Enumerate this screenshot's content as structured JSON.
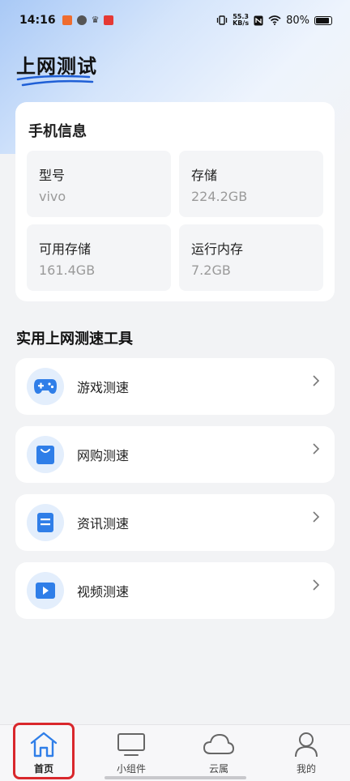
{
  "status_bar": {
    "time": "14:16",
    "net_speed_value": "55.3",
    "net_speed_unit": "KB/s",
    "battery": "80%"
  },
  "page_title": "上网测试",
  "device_info": {
    "title": "手机信息",
    "tiles": [
      {
        "label": "型号",
        "value": "vivo"
      },
      {
        "label": "存储",
        "value": "224.2GB"
      },
      {
        "label": "可用存储",
        "value": "161.4GB"
      },
      {
        "label": "运行内存",
        "value": "7.2GB"
      }
    ]
  },
  "tools": {
    "title": "实用上网测速工具",
    "items": [
      {
        "label": "游戏测速",
        "icon": "gamepad-icon"
      },
      {
        "label": "网购测速",
        "icon": "shopping-bag-icon"
      },
      {
        "label": "资讯测速",
        "icon": "news-icon"
      },
      {
        "label": "视频测速",
        "icon": "video-play-icon"
      }
    ]
  },
  "tabbar": {
    "tabs": [
      {
        "label": "首页",
        "icon": "home-icon",
        "active": true
      },
      {
        "label": "小组件",
        "icon": "monitor-icon",
        "active": false
      },
      {
        "label": "云属",
        "icon": "cloud-icon",
        "active": false
      },
      {
        "label": "我的",
        "icon": "user-icon",
        "active": false
      }
    ]
  },
  "colors": {
    "accent": "#2f7ee8",
    "icon_bg": "#e3eefc",
    "highlight": "#d9272c"
  }
}
